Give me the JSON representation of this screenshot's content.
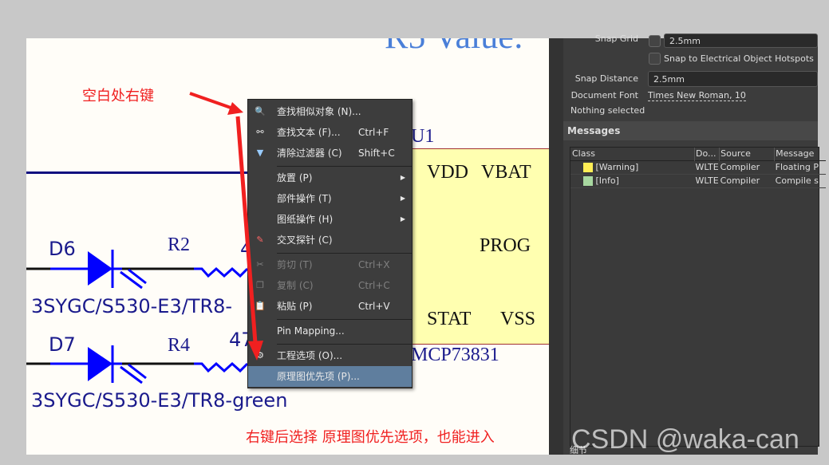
{
  "schematic": {
    "title_partial": "R5 Value:",
    "u1_label": "U1",
    "pins": {
      "vdd": "VDD",
      "vbat": "VBAT",
      "prog": "PROG",
      "stat": "STAT",
      "vss": "VSS"
    },
    "part_name": "MCP73831",
    "d6": "D6",
    "d7": "D7",
    "r2": "R2",
    "r4": "R4",
    "r2_val": "4",
    "r4_val": "47",
    "d6_part": "3SYGC/S530-E3/TR8-",
    "d7_part": "3SYGC/S530-E3/TR8-green"
  },
  "annotations": {
    "right_click": "空白处右键",
    "hint": "右键后选择 原理图优先选项，也能进入",
    "arrow_color": "#f02020"
  },
  "context_menu": {
    "items": [
      {
        "icon": "search-icon",
        "label": "查找相似对象 (N)...",
        "shortcut": ""
      },
      {
        "icon": "binoculars-icon",
        "label": "查找文本 (F)...",
        "shortcut": "Ctrl+F"
      },
      {
        "icon": "clear-filter-icon",
        "label": "清除过滤器 (C)",
        "shortcut": "Shift+C"
      },
      {
        "label": "放置 (P)",
        "submenu": true
      },
      {
        "label": "部件操作 (T)",
        "submenu": true
      },
      {
        "label": "图纸操作 (H)",
        "submenu": true
      },
      {
        "icon": "cross-probe-icon",
        "label": "交叉探针 (C)"
      },
      {
        "icon": "cut-icon",
        "label": "剪切 (T)",
        "shortcut": "Ctrl+X",
        "disabled": true
      },
      {
        "icon": "copy-icon",
        "label": "复制 (C)",
        "shortcut": "Ctrl+C",
        "disabled": true
      },
      {
        "icon": "paste-icon",
        "label": "粘贴 (P)",
        "shortcut": "Ctrl+V"
      },
      {
        "label": "Pin Mapping..."
      },
      {
        "icon": "project-options-icon",
        "label": "工程选项 (O)..."
      },
      {
        "label": "原理图优先项 (P)...",
        "highlighted": true
      }
    ]
  },
  "properties": {
    "snap_grid_label": "Snap Grid",
    "snap_grid_value": "2.5mm",
    "snap_hotspots_label": "Snap to Electrical Object Hotspots",
    "snap_distance_label": "Snap Distance",
    "snap_distance_value": "2.5mm",
    "doc_font_label": "Document Font",
    "doc_font_value": "Times New Roman, 10",
    "selection_status": "Nothing selected"
  },
  "messages": {
    "title": "Messages",
    "columns": [
      "Class",
      "Do...",
      "Source",
      "Message"
    ],
    "rows": [
      {
        "class": "[Warning]",
        "color": "#ffee55",
        "doc": "WLTE",
        "source": "Compiler",
        "message": "Floating P"
      },
      {
        "class": "[Info]",
        "color": "#a8d8a0",
        "doc": "WLTE",
        "source": "Compiler",
        "message": "Compile s"
      }
    ],
    "footer": "细节"
  },
  "watermark": "CSDN @waka-can"
}
